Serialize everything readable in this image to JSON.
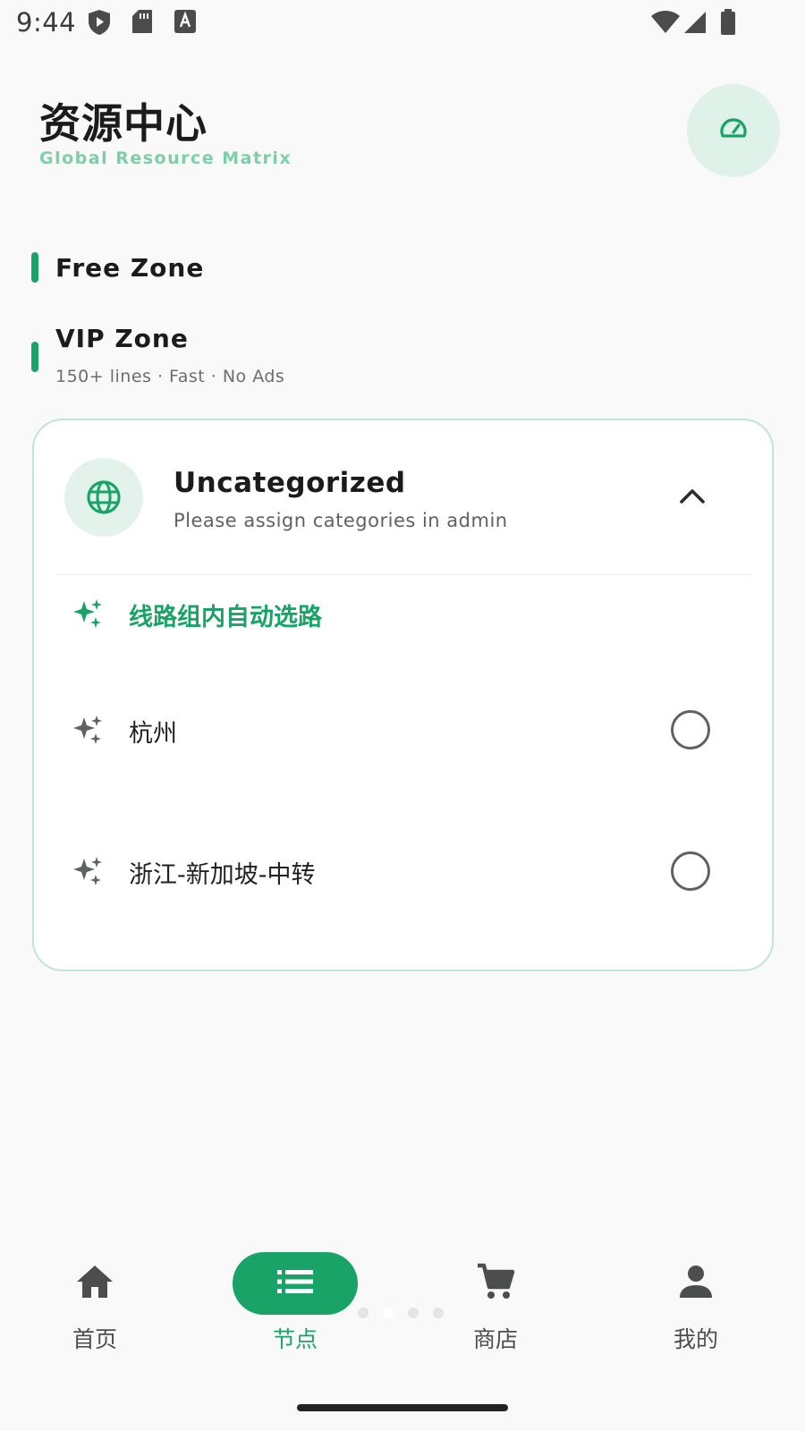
{
  "status_bar": {
    "time": "9:44",
    "left_icons": [
      "shield-play-icon",
      "sd-card-icon",
      "keyboard-a-icon"
    ],
    "right_icons": [
      "wifi-icon",
      "signal-icon",
      "battery-icon"
    ]
  },
  "header": {
    "title": "资源中心",
    "subtitle": "Global Resource Matrix",
    "speed_button_icon": "speedometer-icon"
  },
  "zones": [
    {
      "title": "Free Zone",
      "subtitle": ""
    },
    {
      "title": "VIP Zone",
      "subtitle": "150+ lines · Fast · No Ads"
    }
  ],
  "group": {
    "icon": "globe-icon",
    "title": "Uncategorized",
    "subtitle": "Please assign categories in admin",
    "expanded": true,
    "rows": [
      {
        "label": "线路组内自动选路",
        "icon": "sparkle-icon",
        "type": "auto",
        "selected": false
      },
      {
        "label": "杭州",
        "icon": "sparkle-icon",
        "type": "node",
        "selected": false
      },
      {
        "label": "浙江-新加坡-中转",
        "icon": "sparkle-icon",
        "type": "node",
        "selected": false
      }
    ]
  },
  "bottom_nav": {
    "items": [
      {
        "label": "首页",
        "icon": "home-icon",
        "active": false
      },
      {
        "label": "节点",
        "icon": "list-icon",
        "active": true
      },
      {
        "label": "商店",
        "icon": "cart-icon",
        "active": false
      },
      {
        "label": "我的",
        "icon": "person-icon",
        "active": false
      }
    ]
  },
  "colors": {
    "accent": "#1aa367",
    "accent_light": "#dff2ea",
    "subtitle_green": "#7ecfa8",
    "card_border": "#bfe6d2",
    "background": "#f8f9f8"
  }
}
